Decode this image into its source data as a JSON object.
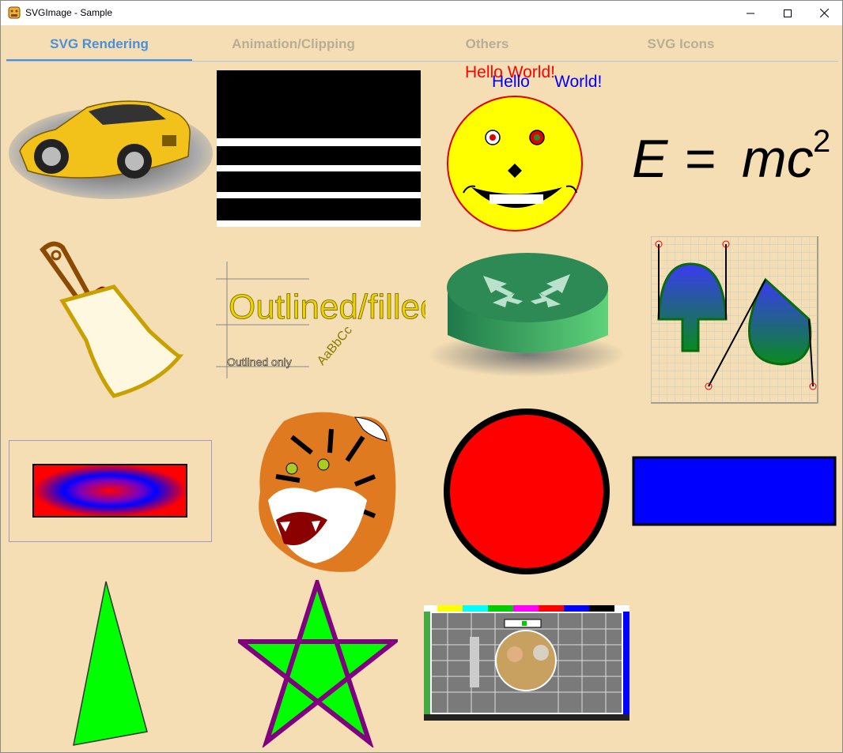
{
  "window": {
    "title": "SVGImage - Sample",
    "app_icon": "svg-app-icon",
    "controls": [
      "minimize-icon",
      "maximize-icon",
      "close-icon"
    ]
  },
  "tabs": [
    {
      "label": "SVG Rendering",
      "active": true
    },
    {
      "label": "Animation/Clipping",
      "active": false
    },
    {
      "label": "Others",
      "active": false
    },
    {
      "label": "SVG Icons",
      "active": false
    }
  ],
  "gallery": {
    "hello_red": "Hello World!",
    "hello_blue_1": "Hello",
    "hello_blue_2": "World!",
    "equation_e": "E",
    "equation_eq": "=",
    "equation_mc": "mc",
    "equation_exp": "2",
    "outlined_filled": "Outlined/filled",
    "outlined_only": "Outlined only",
    "rotated_text": "AaBbCc"
  },
  "colors": {
    "background": "#f5deb3",
    "accent": "#4a90d9",
    "tab_inactive": "#b9ad96"
  }
}
